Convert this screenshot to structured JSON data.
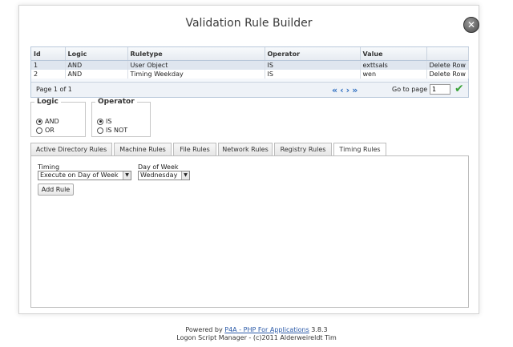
{
  "dialog": {
    "title": "Validation Rule Builder",
    "close_icon": "close-icon"
  },
  "grid": {
    "columns": [
      "Id",
      "Logic",
      "Ruletype",
      "Operator",
      "Value",
      ""
    ],
    "rows": [
      {
        "id": "1",
        "logic": "AND",
        "ruletype": "User Object",
        "operator": "IS",
        "value": "exttsals",
        "action": "Delete Row"
      },
      {
        "id": "2",
        "logic": "AND",
        "ruletype": "Timing Weekday",
        "operator": "IS",
        "value": "wen",
        "action": "Delete Row"
      }
    ],
    "pager": {
      "info": "Page 1 of 1",
      "goto_label": "Go to page",
      "page_value": "1"
    }
  },
  "logic": {
    "legend": "Logic",
    "options": [
      "AND",
      "OR"
    ],
    "selected": "AND"
  },
  "operator": {
    "legend": "Operator",
    "options": [
      "IS",
      "IS NOT"
    ],
    "selected": "IS"
  },
  "tabs": [
    {
      "label": "Active Directory Rules"
    },
    {
      "label": "Machine Rules"
    },
    {
      "label": "File Rules"
    },
    {
      "label": "Network Rules"
    },
    {
      "label": "Registry Rules"
    },
    {
      "label": "Timing Rules",
      "active": true
    }
  ],
  "timing": {
    "timing_label": "Timing",
    "timing_value": "Execute on Day of Week",
    "dow_label": "Day of Week",
    "dow_value": "Wednesday",
    "add_button": "Add Rule"
  },
  "footer": {
    "powered_prefix": "Powered by ",
    "powered_link": "P4A - PHP For Applications",
    "version": " 3.8.3",
    "line2": "Logon Script Manager - (c)2011 Alderweireldt Tim"
  },
  "colors": {
    "accent": "#2f6fc1",
    "check": "#3aa33a",
    "grid_header": "#e6ebf1",
    "selected_row": "#dfe6ef"
  }
}
